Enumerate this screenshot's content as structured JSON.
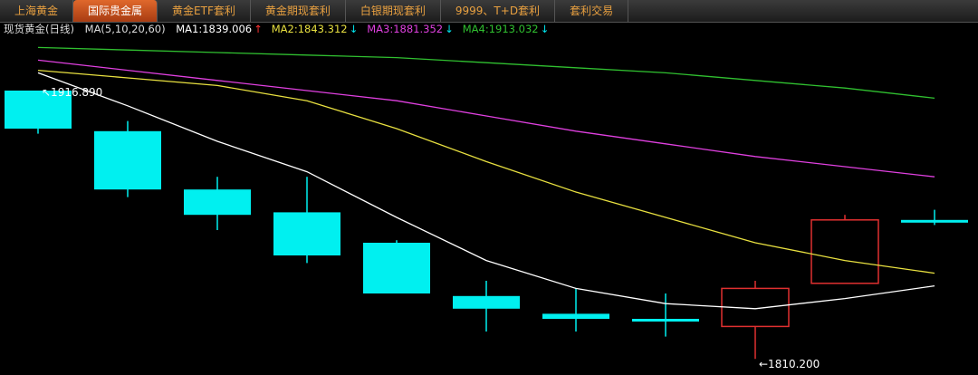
{
  "tabs": [
    {
      "label": "上海黄金",
      "active": false
    },
    {
      "label": "国际贵金属",
      "active": true
    },
    {
      "label": "黄金ETF套利",
      "active": false
    },
    {
      "label": "黄金期现套利",
      "active": false
    },
    {
      "label": "白银期现套利",
      "active": false
    },
    {
      "label": "9999、T+D套利",
      "active": false
    },
    {
      "label": "套利交易",
      "active": false
    }
  ],
  "legend": {
    "title": "现货黄金(日线)",
    "ma_params": "MA(5,10,20,60)",
    "items": [
      {
        "label": "MA1:1839.006",
        "arrow": "↑",
        "color": "#ffffff",
        "arrow_color": "#ff3333"
      },
      {
        "label": "MA2:1843.312",
        "arrow": "↓",
        "color": "#e8e040",
        "arrow_color": "#00e8f0"
      },
      {
        "label": "MA3:1881.352",
        "arrow": "↓",
        "color": "#e040e0",
        "arrow_color": "#00e8f0"
      },
      {
        "label": "MA4:1913.032",
        "arrow": "↓",
        "color": "#30c030",
        "arrow_color": "#00e8f0"
      }
    ]
  },
  "chart_data": {
    "type": "candlestick",
    "title": "现货黄金(日线)",
    "ylim": [
      1806,
      1936
    ],
    "x": [
      1,
      2,
      3,
      4,
      5,
      6,
      7,
      8,
      9,
      10,
      11
    ],
    "candles": [
      {
        "open": 1916.0,
        "close": 1901.0,
        "high": 1916.0,
        "low": 1899.0,
        "dir": "down"
      },
      {
        "open": 1900.0,
        "close": 1877.0,
        "high": 1904.0,
        "low": 1874.0,
        "dir": "down"
      },
      {
        "open": 1877.0,
        "close": 1867.0,
        "high": 1882.0,
        "low": 1861.0,
        "dir": "down"
      },
      {
        "open": 1868.0,
        "close": 1851.0,
        "high": 1882.0,
        "low": 1848.0,
        "dir": "down"
      },
      {
        "open": 1856.0,
        "close": 1836.0,
        "high": 1857.0,
        "low": 1836.0,
        "dir": "down"
      },
      {
        "open": 1835.0,
        "close": 1830.0,
        "high": 1841.0,
        "low": 1821.0,
        "dir": "down"
      },
      {
        "open": 1828.0,
        "close": 1826.0,
        "high": 1838.0,
        "low": 1821.0,
        "dir": "down"
      },
      {
        "open": 1826.0,
        "close": 1825.0,
        "high": 1836.0,
        "low": 1819.0,
        "dir": "down"
      },
      {
        "open": 1823.0,
        "close": 1838.0,
        "high": 1841.0,
        "low": 1810.2,
        "dir": "up"
      },
      {
        "open": 1840.0,
        "close": 1865.0,
        "high": 1867.0,
        "low": 1840.0,
        "dir": "up"
      },
      {
        "open": 1865.0,
        "close": 1865.0,
        "high": 1869.0,
        "low": 1863.0,
        "dir": "flat"
      }
    ],
    "series": [
      {
        "name": "MA1",
        "color": "#ffffff",
        "values": [
          1923,
          1910,
          1896,
          1884,
          1866,
          1849,
          1838,
          1832,
          1830,
          1834,
          1839
        ]
      },
      {
        "name": "MA2",
        "color": "#e8e040",
        "values": [
          1924,
          1921,
          1918,
          1912,
          1901,
          1888,
          1876,
          1866,
          1856,
          1849,
          1844
        ]
      },
      {
        "name": "MA3",
        "color": "#e040e0",
        "values": [
          1928,
          1924,
          1920,
          1916,
          1912,
          1906,
          1900,
          1895,
          1890,
          1886,
          1882
        ]
      },
      {
        "name": "MA4",
        "color": "#30c030",
        "values": [
          1933,
          1932,
          1931,
          1930,
          1929,
          1927,
          1925,
          1923,
          1920,
          1917,
          1913
        ]
      }
    ],
    "annotations": [
      {
        "label": "1916.890",
        "target": "high",
        "candle": 0
      },
      {
        "label": "1810.200",
        "target": "low",
        "candle": 8
      }
    ],
    "colors": {
      "down": "#00f0f0",
      "up": "#e03030"
    }
  }
}
